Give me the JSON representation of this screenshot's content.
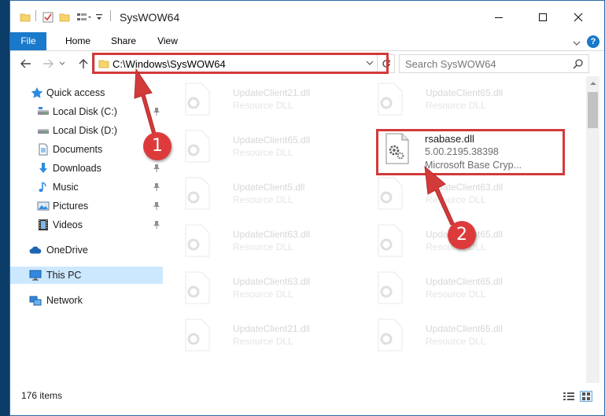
{
  "window": {
    "title": "SysWOW64"
  },
  "ribbon": {
    "tabs": [
      "File",
      "Home",
      "Share",
      "View"
    ],
    "help_label": "?"
  },
  "navigation": {
    "address_path": "C:\\Windows\\SysWOW64",
    "search_placeholder": "Search SysWOW64"
  },
  "sidebar": {
    "items": [
      {
        "label": "Quick access",
        "icon": "star-icon"
      },
      {
        "label": "Local Disk (C:)",
        "icon": "drive-icon",
        "pinned": true
      },
      {
        "label": "Local Disk (D:)",
        "icon": "drive-icon"
      },
      {
        "label": "Documents",
        "icon": "documents-icon"
      },
      {
        "label": "Downloads",
        "icon": "download-arrow-icon",
        "pinned": true
      },
      {
        "label": "Music",
        "icon": "music-note-icon",
        "pinned": true
      },
      {
        "label": "Pictures",
        "icon": "pictures-icon",
        "pinned": true
      },
      {
        "label": "Videos",
        "icon": "film-icon",
        "pinned": true
      },
      {
        "label": "OneDrive",
        "icon": "cloud-icon"
      },
      {
        "label": "This PC",
        "icon": "monitor-icon",
        "selected": true
      },
      {
        "label": "Network",
        "icon": "network-icon"
      }
    ]
  },
  "files": {
    "left_column": [
      {
        "name": "UpdateClient21.dll",
        "type": "Resource DLL"
      },
      {
        "name": "UpdateClient65.dll",
        "type": "Resource DLL"
      },
      {
        "name": "UpdateClient5.dll",
        "type": "Resource DLL"
      },
      {
        "name": "UpdateClient63.dll",
        "type": "Resource DLL"
      },
      {
        "name": "UpdateClient63.dll",
        "type": "Resource DLL"
      },
      {
        "name": "UpdateClient21.dll",
        "type": "Resource DLL"
      }
    ],
    "right_column": [
      {
        "name": "UpdateClient65.dll",
        "type": "Resource DLL"
      },
      {
        "name": "UpdateClient63.dll",
        "type": "Resource DLL"
      },
      {
        "name": "UpdateClient65.dll",
        "type": "Resource DLL"
      },
      {
        "name": "UpdateClient65.dll",
        "type": "Resource DLL"
      },
      {
        "name": "UpdateClient65.dll",
        "type": "Resource DLL"
      }
    ],
    "highlighted": {
      "name": "rsabase.dll",
      "version": "5.00.2195.38398",
      "description": "Microsoft Base Cryp..."
    }
  },
  "status": {
    "item_count": "176 items"
  },
  "annotations": {
    "callout_1": "1",
    "callout_2": "2",
    "color": "#d33a3a"
  },
  "colors": {
    "accent": "#1979ca",
    "selection": "#cce8ff",
    "frame": "#0b3c68"
  }
}
